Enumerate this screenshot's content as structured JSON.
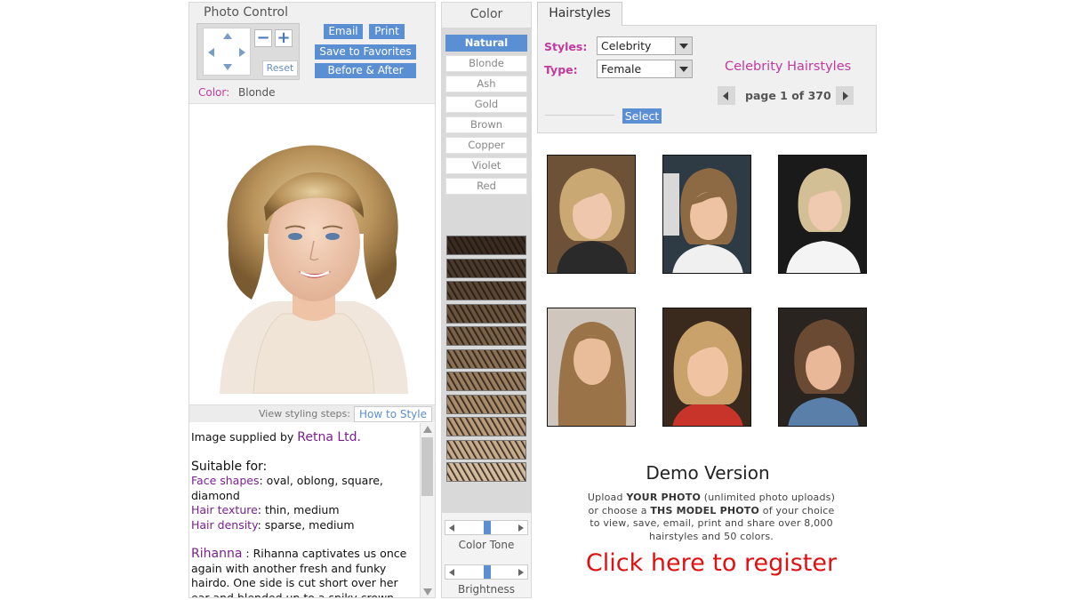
{
  "photo_control": {
    "title": "Photo Control",
    "zoom_out": "−",
    "zoom_in": "+",
    "reset": "Reset",
    "email": "Email",
    "print": "Print",
    "save_favorites": "Save to Favorites",
    "before_after": "Before & After",
    "color_label": "Color:",
    "color_value": "Blonde"
  },
  "steps": {
    "text": "View styling steps:",
    "how_to": "How to Style"
  },
  "info": {
    "supplied_prefix": "Image supplied by ",
    "supplier": "Retna Ltd.",
    "suitable": "Suitable for:",
    "face_label": "Face shapes",
    "face_value": ": oval, oblong, square, diamond",
    "texture_label": "Hair texture",
    "texture_value": ": thin, medium",
    "density_label": "Hair density",
    "density_value": ": sparse, medium",
    "celebrity": "Rihanna",
    "description": " : Rihanna captivates us once again with another fresh and funky hairdo. One side is cut short over her ear and blended up to a spiky crown"
  },
  "color": {
    "title": "Color",
    "options": [
      "Natural",
      "Blonde",
      "Ash",
      "Gold",
      "Brown",
      "Copper",
      "Violet",
      "Red"
    ],
    "active": "Natural",
    "tone_label": "Color Tone",
    "brightness_label": "Brightness",
    "tone_value": 0.5,
    "brightness_value": 0.5
  },
  "hairstyles": {
    "tab": "Hairstyles",
    "styles_label": "Styles:",
    "styles_value": "Celebrity",
    "type_label": "Type:",
    "type_value": "Female",
    "heading": "Celebrity Hairstyles",
    "page_text": "page 1 of 370",
    "select": "Select"
  },
  "demo": {
    "title": "Demo Version",
    "line1_pre": "Upload ",
    "line1_bold": "YOUR PHOTO",
    "line1_post": " (unlimited photo uploads)",
    "line2_pre": "or choose a ",
    "line2_bold": "THS MODEL PHOTO",
    "line2_post": " of your choice",
    "line3": "to view, save, email, print and share over 8,000",
    "line4": "hairstyles and 50 colors.",
    "register": "Click here to register"
  },
  "colors": {
    "accent_blue": "#5b8fd3",
    "magenta": "#c03aa0",
    "register_red": "#e01010"
  }
}
